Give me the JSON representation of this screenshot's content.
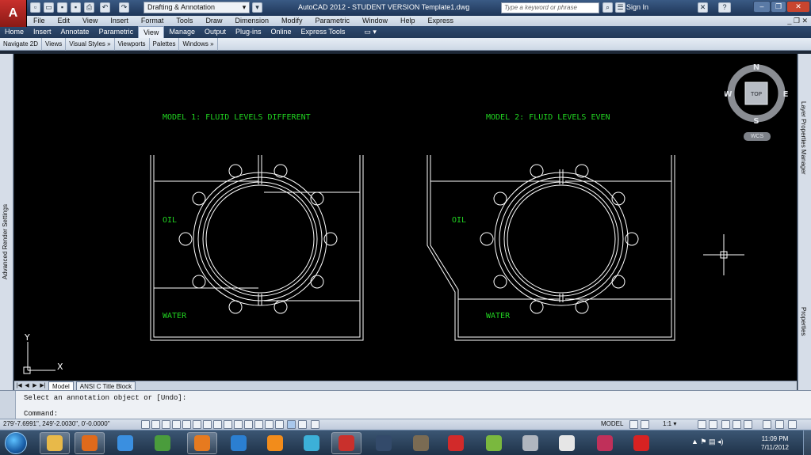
{
  "titlebar": {
    "app_letter": "A",
    "workspace": "Drafting & Annotation",
    "title": "AutoCAD 2012 - STUDENT VERSION    Template1.dwg",
    "search_placeholder": "Type a keyword or phrase",
    "sign_in": "Sign In",
    "help": "?"
  },
  "menubar": {
    "items": [
      "File",
      "Edit",
      "View",
      "Insert",
      "Format",
      "Tools",
      "Draw",
      "Dimension",
      "Modify",
      "Parametric",
      "Window",
      "Help",
      "Express"
    ],
    "doc_controls": "_ ❐ ✕"
  },
  "ribbon": {
    "tabs": [
      "Home",
      "Insert",
      "Annotate",
      "Parametric",
      "View",
      "Manage",
      "Output",
      "Plug-ins",
      "Online",
      "Express Tools"
    ],
    "active_tab": "View",
    "tab_extra": "▭ ▾",
    "panels": [
      "Navigate 2D",
      "Views",
      "Visual Styles »",
      "Viewports",
      "Palettes",
      "Windows »"
    ]
  },
  "palettes": {
    "left": "Advanced Render Settings",
    "right_top": "Layer Properties Manager",
    "right_bottom": "Properties"
  },
  "drawing": {
    "model1_title": "MODEL 1: FLUID LEVELS DIFFERENT",
    "model2_title": "MODEL 2: FLUID LEVELS EVEN",
    "oil_label": "OIL",
    "water_label": "WATER",
    "ucs_x": "X",
    "ucs_y": "Y"
  },
  "viewcube": {
    "n": "N",
    "s": "S",
    "e": "E",
    "w": "W",
    "face": "TOP",
    "wcs": "WCS"
  },
  "layout_tabs": {
    "nav": [
      "|◀",
      "◀",
      "▶",
      "▶|"
    ],
    "tabs": [
      "Model",
      "ANSI C Title Block"
    ],
    "active": "Model"
  },
  "command": {
    "history": "Select an annotation object or [Undo]:",
    "prompt": "Command:"
  },
  "statusbar": {
    "coords": "279'-7.6991\", 249'-2.0030\", 0'-0.0000\"",
    "model": "MODEL",
    "scale": "1:1 ▾"
  },
  "taskbar": {
    "time": "11:09 PM",
    "date": "7/11/2012",
    "apps": [
      {
        "name": "explorer-icon",
        "color": "#e8b949",
        "running": true
      },
      {
        "name": "media-player-icon",
        "color": "#e06a1b",
        "running": true
      },
      {
        "name": "internet-explorer-icon",
        "color": "#3a8fe0",
        "running": false
      },
      {
        "name": "google-chrome-icon",
        "color": "#4a9c3c",
        "running": false
      },
      {
        "name": "firefox-icon",
        "color": "#e67a1f",
        "running": true
      },
      {
        "name": "quicktime-icon",
        "color": "#2b7fd1",
        "running": false
      },
      {
        "name": "vlc-icon",
        "color": "#f28c1b",
        "running": false
      },
      {
        "name": "network-icon",
        "color": "#3cb0d8",
        "running": false
      },
      {
        "name": "autocad-icon",
        "color": "#c9302c",
        "running": true
      },
      {
        "name": "app-dark-icon",
        "color": "#334a6a",
        "running": false
      },
      {
        "name": "app-ft-icon",
        "color": "#7a6b53",
        "running": false
      },
      {
        "name": "solidworks-icon",
        "color": "#d22a2a",
        "running": false
      },
      {
        "name": "java-icon",
        "color": "#7ab83e",
        "running": false
      },
      {
        "name": "pen-icon",
        "color": "#b0b6bf",
        "running": false
      },
      {
        "name": "wiki-icon",
        "color": "#e6e6e6",
        "running": false
      },
      {
        "name": "project-icon",
        "color": "#c0305a",
        "running": false
      },
      {
        "name": "m-app-icon",
        "color": "#d82222",
        "running": false
      }
    ]
  }
}
